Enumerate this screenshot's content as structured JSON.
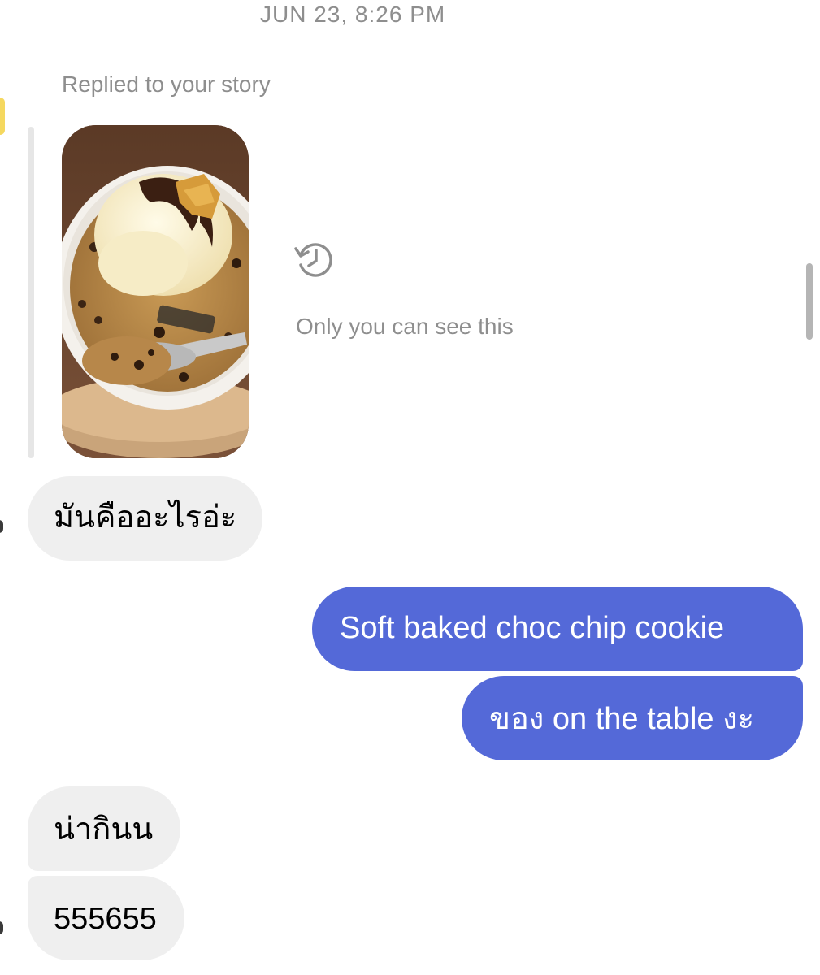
{
  "header": {
    "timestamp": "JUN 23, 8:26 PM"
  },
  "story_reply": {
    "label": "Replied to your story",
    "thumbnail_icon": "cookie-ice-cream-photo",
    "hidden_icon": "history-clock-icon",
    "hidden_note": "Only you can see this"
  },
  "messages": [
    {
      "direction": "incoming",
      "text": "มันคืออะไรอ่ะ"
    },
    {
      "direction": "outgoing",
      "text": "Soft baked choc chip cookie"
    },
    {
      "direction": "outgoing",
      "text": "ของ on the table งะ"
    },
    {
      "direction": "incoming",
      "text": "น่ากินน"
    },
    {
      "direction": "incoming",
      "text": "555655"
    }
  ],
  "colors": {
    "outgoing_bubble": "#5469d8",
    "incoming_bubble": "#efefef",
    "meta_text": "#8e8e8e"
  }
}
